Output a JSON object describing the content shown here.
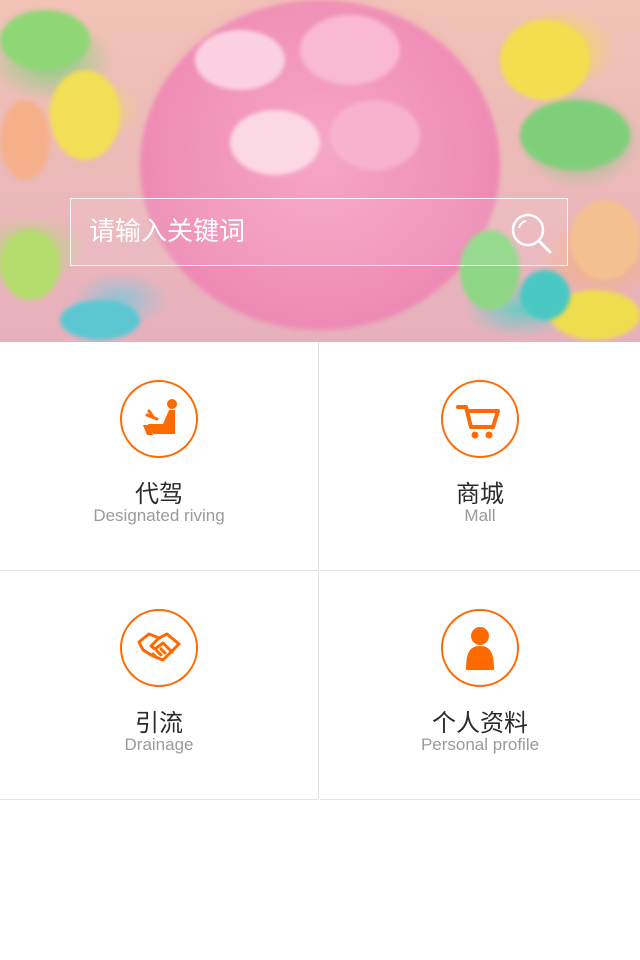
{
  "search": {
    "placeholder": "请输入关键词"
  },
  "menu": [
    {
      "title": "代驾",
      "subtitle": "Designated riving",
      "icon": "driver-seat-icon"
    },
    {
      "title": "商城",
      "subtitle": "Mall",
      "icon": "shopping-cart-icon"
    },
    {
      "title": "引流",
      "subtitle": "Drainage",
      "icon": "handshake-icon"
    },
    {
      "title": "个人资料",
      "subtitle": "Personal profile",
      "icon": "person-icon"
    }
  ],
  "colors": {
    "accent": "#ff6a00",
    "divider": "#e2e2e2"
  }
}
